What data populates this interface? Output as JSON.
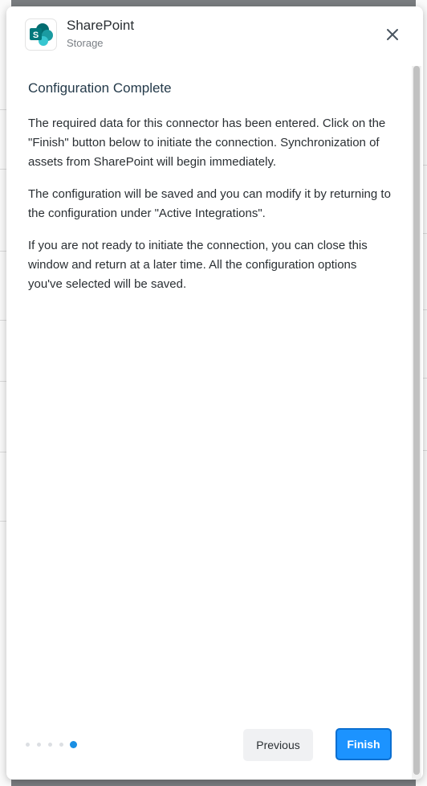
{
  "header": {
    "title": "SharePoint",
    "subtitle": "Storage",
    "logo_icon": "sharepoint-logo-icon",
    "close_icon": "close-icon"
  },
  "content": {
    "heading": "Configuration Complete",
    "paragraphs": [
      "The required data for this connector has been entered. Click on the \"Finish\" button below to initiate the connection. Synchronization of assets from SharePoint will begin immediately.",
      "The configuration will be saved and you can modify it by returning to the configuration under \"Active Integrations\".",
      "If you are not ready to initiate the connection, you can close this window and return at a later time. All the configuration options you've selected will be saved."
    ]
  },
  "footer": {
    "steps_total": 5,
    "current_step": 5,
    "previous_label": "Previous",
    "finish_label": "Finish"
  },
  "colors": {
    "accent": "#1c93ff",
    "heading": "#243a4a",
    "logo_dark": "#036c70",
    "logo_mid": "#1a9ba1",
    "logo_light": "#37c6d0"
  }
}
